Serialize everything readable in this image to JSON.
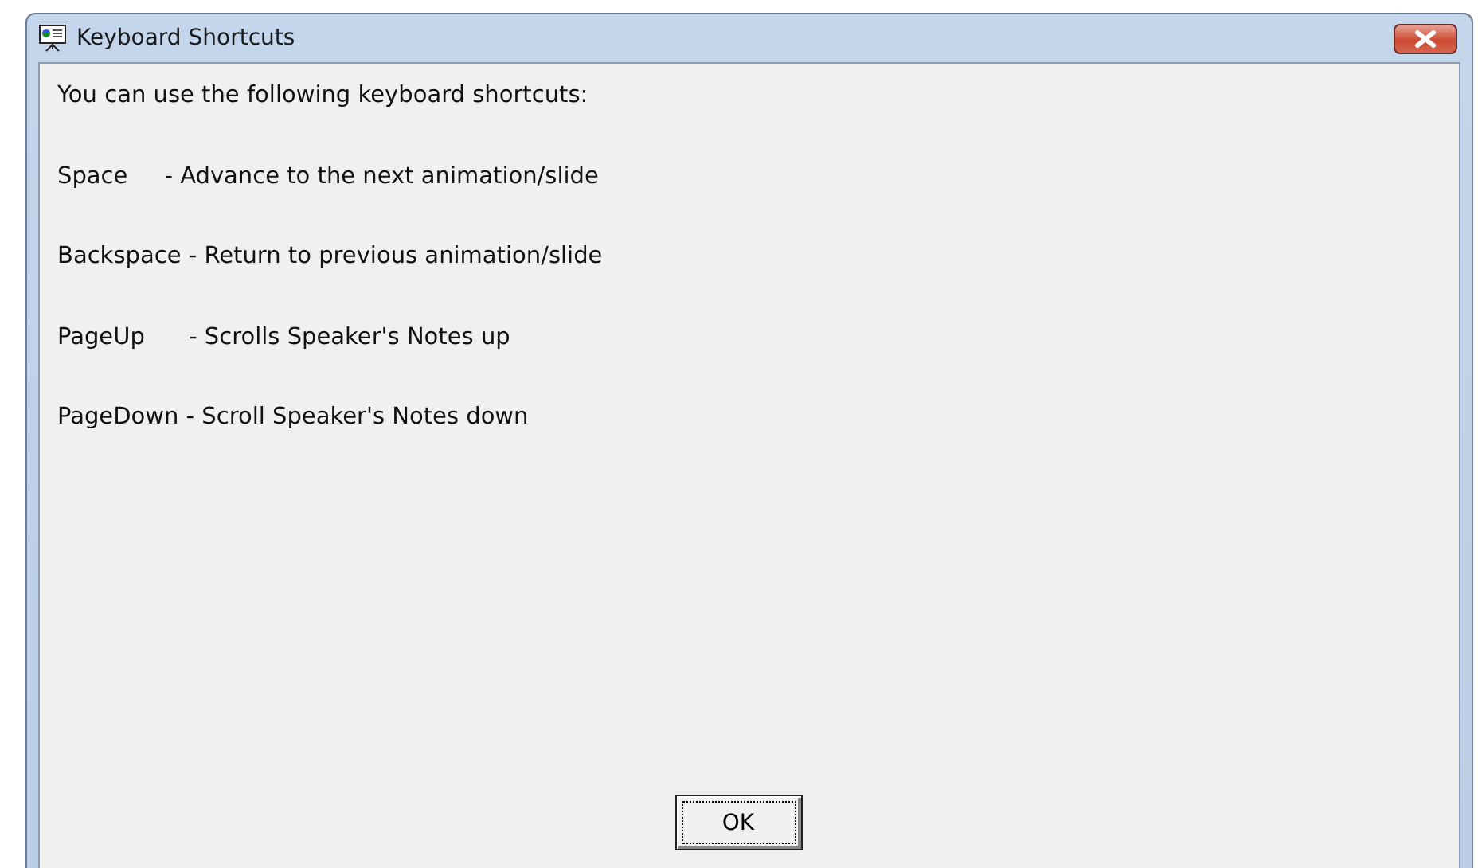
{
  "window": {
    "title": "Keyboard Shortcuts"
  },
  "intro": "You can use the following keyboard shortcuts:",
  "shortcuts": [
    "Space     - Advance to the next animation/slide",
    "Backspace - Return to previous animation/slide",
    "PageUp      - Scrolls Speaker's Notes up",
    "PageDown - Scroll Speaker's Notes down"
  ],
  "buttons": [
    "OK"
  ]
}
